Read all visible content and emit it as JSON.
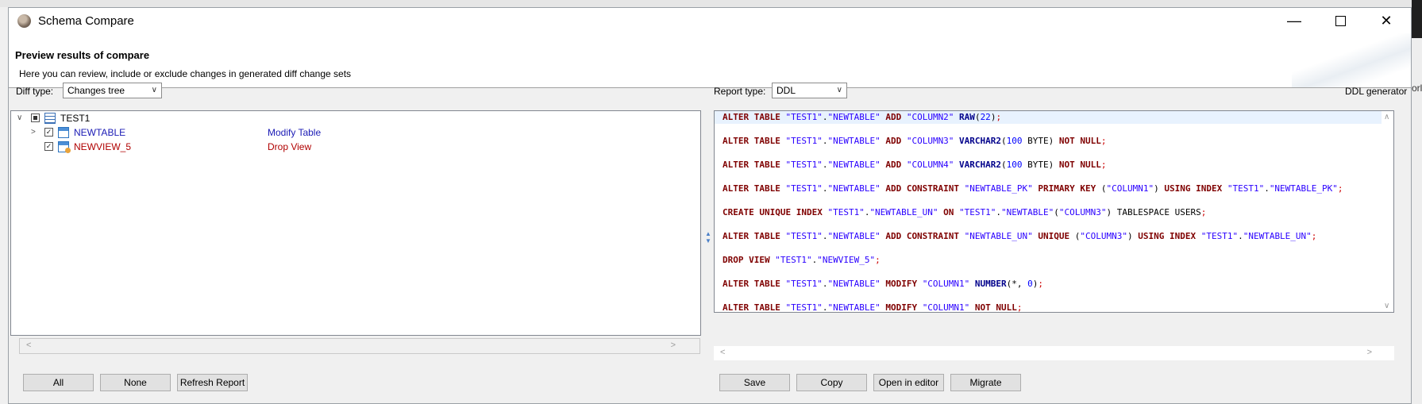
{
  "window": {
    "title": "Schema Compare",
    "edge_text": "orl"
  },
  "header": {
    "title": "Preview results of compare",
    "description": "Here you can review, include or exclude changes in generated diff change sets"
  },
  "diff": {
    "label": "Diff type:",
    "value": "Changes tree"
  },
  "report": {
    "label": "Report type:",
    "value": "DDL",
    "generator": "DDL generator"
  },
  "tree": {
    "root": "TEST1",
    "items": [
      {
        "name": "NEWTABLE",
        "action": "Modify Table",
        "color": "#1a1ab5",
        "icon": "table-icon"
      },
      {
        "name": "NEWVIEW_5",
        "action": "Drop View",
        "color": "#b00000",
        "icon": "view-icon"
      }
    ]
  },
  "ddl": {
    "lines": [
      [
        [
          "kw",
          "ALTER TABLE "
        ],
        [
          "str",
          "\"TEST1\""
        ],
        [
          "plain",
          "."
        ],
        [
          "str",
          "\"NEWTABLE\""
        ],
        [
          "kw",
          " ADD "
        ],
        [
          "str",
          "\"COLUMN2\""
        ],
        [
          "tp",
          " RAW"
        ],
        [
          "plain",
          "("
        ],
        [
          "num",
          "22"
        ],
        [
          "plain",
          ")"
        ],
        [
          "sym",
          ";"
        ]
      ],
      [
        [
          "kw",
          "ALTER TABLE "
        ],
        [
          "str",
          "\"TEST1\""
        ],
        [
          "plain",
          "."
        ],
        [
          "str",
          "\"NEWTABLE\""
        ],
        [
          "kw",
          " ADD "
        ],
        [
          "str",
          "\"COLUMN3\""
        ],
        [
          "tp",
          " VARCHAR2"
        ],
        [
          "plain",
          "("
        ],
        [
          "num",
          "100"
        ],
        [
          "plain",
          " BYTE) "
        ],
        [
          "kw",
          "NOT NULL"
        ],
        [
          "sym",
          ";"
        ]
      ],
      [
        [
          "kw",
          "ALTER TABLE "
        ],
        [
          "str",
          "\"TEST1\""
        ],
        [
          "plain",
          "."
        ],
        [
          "str",
          "\"NEWTABLE\""
        ],
        [
          "kw",
          " ADD "
        ],
        [
          "str",
          "\"COLUMN4\""
        ],
        [
          "tp",
          " VARCHAR2"
        ],
        [
          "plain",
          "("
        ],
        [
          "num",
          "100"
        ],
        [
          "plain",
          " BYTE) "
        ],
        [
          "kw",
          "NOT NULL"
        ],
        [
          "sym",
          ";"
        ]
      ],
      [
        [
          "kw",
          "ALTER TABLE "
        ],
        [
          "str",
          "\"TEST1\""
        ],
        [
          "plain",
          "."
        ],
        [
          "str",
          "\"NEWTABLE\""
        ],
        [
          "kw",
          " ADD CONSTRAINT "
        ],
        [
          "str",
          "\"NEWTABLE_PK\""
        ],
        [
          "kw",
          " PRIMARY KEY "
        ],
        [
          "plain",
          "("
        ],
        [
          "str",
          "\"COLUMN1\""
        ],
        [
          "plain",
          ") "
        ],
        [
          "kw",
          "USING INDEX "
        ],
        [
          "str",
          "\"TEST1\""
        ],
        [
          "plain",
          "."
        ],
        [
          "str",
          "\"NEWTABLE_PK\""
        ],
        [
          "sym",
          ";"
        ]
      ],
      [
        [
          "kw",
          "CREATE UNIQUE INDEX "
        ],
        [
          "str",
          "\"TEST1\""
        ],
        [
          "plain",
          "."
        ],
        [
          "str",
          "\"NEWTABLE_UN\""
        ],
        [
          "kw",
          " ON "
        ],
        [
          "str",
          "\"TEST1\""
        ],
        [
          "plain",
          "."
        ],
        [
          "str",
          "\"NEWTABLE\""
        ],
        [
          "plain",
          "("
        ],
        [
          "str",
          "\"COLUMN3\""
        ],
        [
          "plain",
          ") TABLESPACE USERS"
        ],
        [
          "sym",
          ";"
        ]
      ],
      [
        [
          "kw",
          "ALTER TABLE "
        ],
        [
          "str",
          "\"TEST1\""
        ],
        [
          "plain",
          "."
        ],
        [
          "str",
          "\"NEWTABLE\""
        ],
        [
          "kw",
          " ADD CONSTRAINT "
        ],
        [
          "str",
          "\"NEWTABLE_UN\""
        ],
        [
          "kw",
          " UNIQUE "
        ],
        [
          "plain",
          "("
        ],
        [
          "str",
          "\"COLUMN3\""
        ],
        [
          "plain",
          ") "
        ],
        [
          "kw",
          "USING INDEX "
        ],
        [
          "str",
          "\"TEST1\""
        ],
        [
          "plain",
          "."
        ],
        [
          "str",
          "\"NEWTABLE_UN\""
        ],
        [
          "sym",
          ";"
        ]
      ],
      [
        [
          "kw",
          "DROP VIEW "
        ],
        [
          "str",
          "\"TEST1\""
        ],
        [
          "plain",
          "."
        ],
        [
          "str",
          "\"NEWVIEW_5\""
        ],
        [
          "sym",
          ";"
        ]
      ],
      [
        [
          "kw",
          "ALTER TABLE "
        ],
        [
          "str",
          "\"TEST1\""
        ],
        [
          "plain",
          "."
        ],
        [
          "str",
          "\"NEWTABLE\""
        ],
        [
          "kw",
          " MODIFY "
        ],
        [
          "str",
          "\"COLUMN1\""
        ],
        [
          "tp",
          " NUMBER"
        ],
        [
          "plain",
          "(*, "
        ],
        [
          "num",
          "0"
        ],
        [
          "plain",
          ")"
        ],
        [
          "sym",
          ";"
        ]
      ],
      [
        [
          "kw",
          "ALTER TABLE "
        ],
        [
          "str",
          "\"TEST1\""
        ],
        [
          "plain",
          "."
        ],
        [
          "str",
          "\"NEWTABLE\""
        ],
        [
          "kw",
          " MODIFY "
        ],
        [
          "str",
          "\"COLUMN1\""
        ],
        [
          "kw",
          " NOT NULL"
        ],
        [
          "sym",
          ";"
        ]
      ]
    ]
  },
  "buttons": {
    "all": "All",
    "none": "None",
    "refresh": "Refresh Report",
    "save": "Save",
    "copy": "Copy",
    "open": "Open in editor",
    "migrate": "Migrate"
  }
}
